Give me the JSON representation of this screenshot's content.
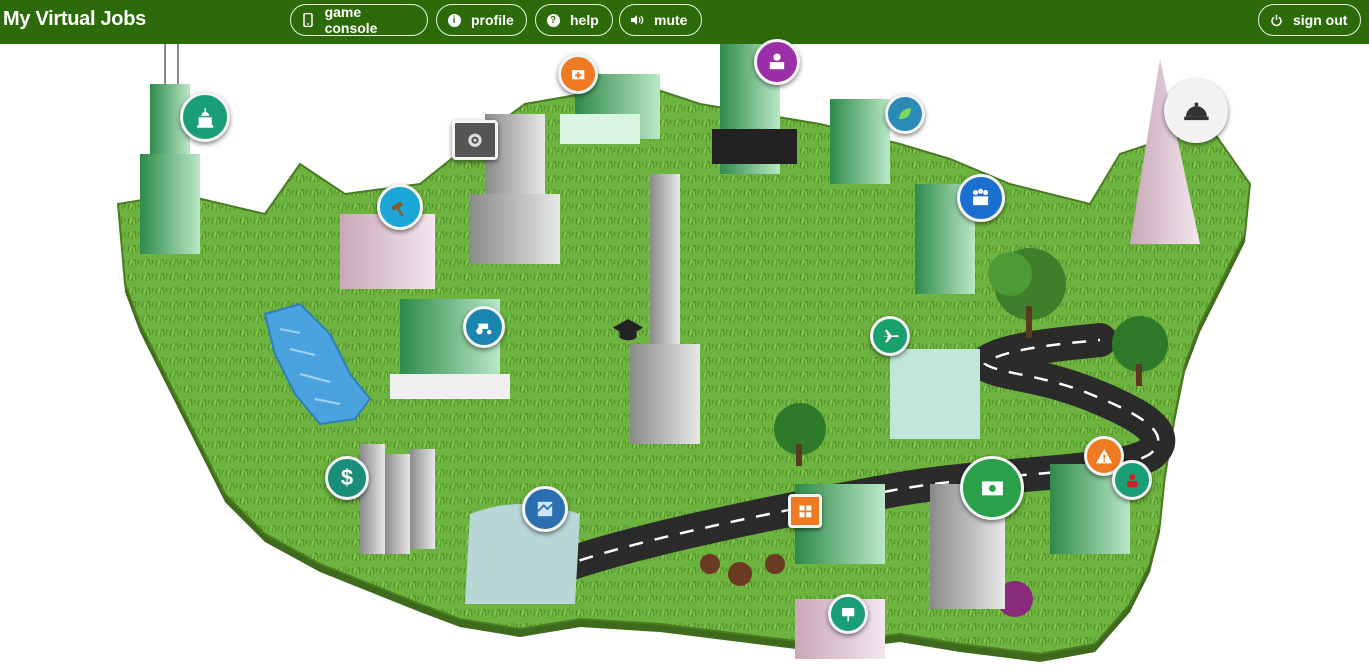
{
  "app": {
    "title": "My Virtual Jobs"
  },
  "toolbar": {
    "game_console": "game console",
    "profile": "profile",
    "help": "help",
    "mute": "mute",
    "sign_out": "sign out"
  },
  "icons": {
    "game_console": "mobile-device-icon",
    "profile": "info-icon",
    "help": "question-icon",
    "mute": "speaker-icon",
    "sign_out": "power-icon"
  },
  "colors": {
    "header_bg": "#2d6a0a",
    "grass": "#6db33f",
    "road": "#2b2b2b",
    "water": "#4aa3df"
  },
  "map_locations": [
    {
      "name": "government",
      "icon": "capitol-dome-icon",
      "color": "#1a9e78"
    },
    {
      "name": "law",
      "icon": "gavel-icon",
      "color": "#1aa6d6"
    },
    {
      "name": "technology",
      "icon": "gear-icon",
      "color": "#555555"
    },
    {
      "name": "health",
      "icon": "first-aid-icon",
      "color": "#f07a22"
    },
    {
      "name": "manufacturing",
      "icon": "workers-icon",
      "color": "#9b2fa8"
    },
    {
      "name": "environment",
      "icon": "leaf-icon",
      "color": "#2a8bb6"
    },
    {
      "name": "hospitality",
      "icon": "service-bell-icon",
      "color": "#1a9e78"
    },
    {
      "name": "human-services",
      "icon": "people-icon",
      "color": "#1a6fd0"
    },
    {
      "name": "transportation",
      "icon": "airplane-icon",
      "color": "#1aa06a"
    },
    {
      "name": "agriculture",
      "icon": "tractor-icon",
      "color": "#1a86b0"
    },
    {
      "name": "education",
      "icon": "graduation-cap-icon",
      "color": "#222222"
    },
    {
      "name": "finance",
      "icon": "dollar-icon",
      "color": "#1a8e78"
    },
    {
      "name": "architecture",
      "icon": "blueprint-icon",
      "color": "#2a70b0"
    },
    {
      "name": "business",
      "icon": "calculator-icon",
      "color": "#f07a22"
    },
    {
      "name": "marketing",
      "icon": "money-icon",
      "color": "#2aa04a"
    },
    {
      "name": "public-safety",
      "icon": "warning-icon",
      "color": "#f07a22"
    },
    {
      "name": "arts",
      "icon": "presentation-icon",
      "color": "#1a9e78"
    }
  ]
}
